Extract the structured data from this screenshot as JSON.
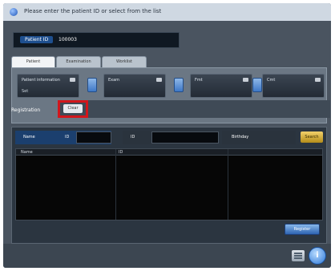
{
  "app": {
    "title": "Please enter the patient ID or select from the list"
  },
  "header": {
    "badge": "Patient ID",
    "value": "100003"
  },
  "tabs": [
    {
      "label": "Patient",
      "active": true
    },
    {
      "label": "Examination",
      "active": false
    },
    {
      "label": "Worklist",
      "active": false
    }
  ],
  "cards": [
    {
      "label": "Patient information",
      "sub": "Set"
    },
    {
      "label": "Exam",
      "sub": ""
    },
    {
      "label": "Fmt",
      "sub": ""
    },
    {
      "label": "Cmt",
      "sub": ""
    }
  ],
  "register": {
    "label": "Registration",
    "button": "Clear"
  },
  "search": {
    "name_label": "Name",
    "id_label": "ID",
    "id_label2": "ID",
    "birth_label": "Birthday",
    "button": "Search"
  },
  "list": {
    "columns": [
      "Name",
      "ID",
      ""
    ]
  },
  "ok_button": "Register",
  "footer": {
    "help_icon": "i"
  }
}
